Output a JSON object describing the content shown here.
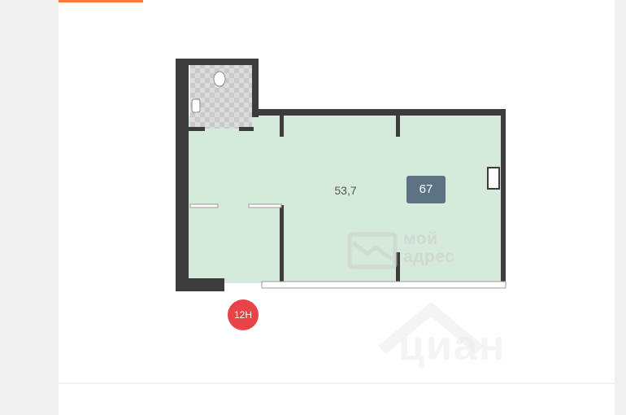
{
  "floor_plan": {
    "area_label": "53,7",
    "room_number": "67",
    "unit_badge": "12Н",
    "watermark": {
      "line1": "мой",
      "line2": "адрес",
      "brand": "циан"
    },
    "colors": {
      "room_fill": "#d6eadb",
      "wall": "#3d3b3c",
      "bathroom_tile": "#d3d3d3",
      "room_number_bg": "#5d7283",
      "badge": "#e9434a",
      "accent": "#f47c3c"
    }
  }
}
